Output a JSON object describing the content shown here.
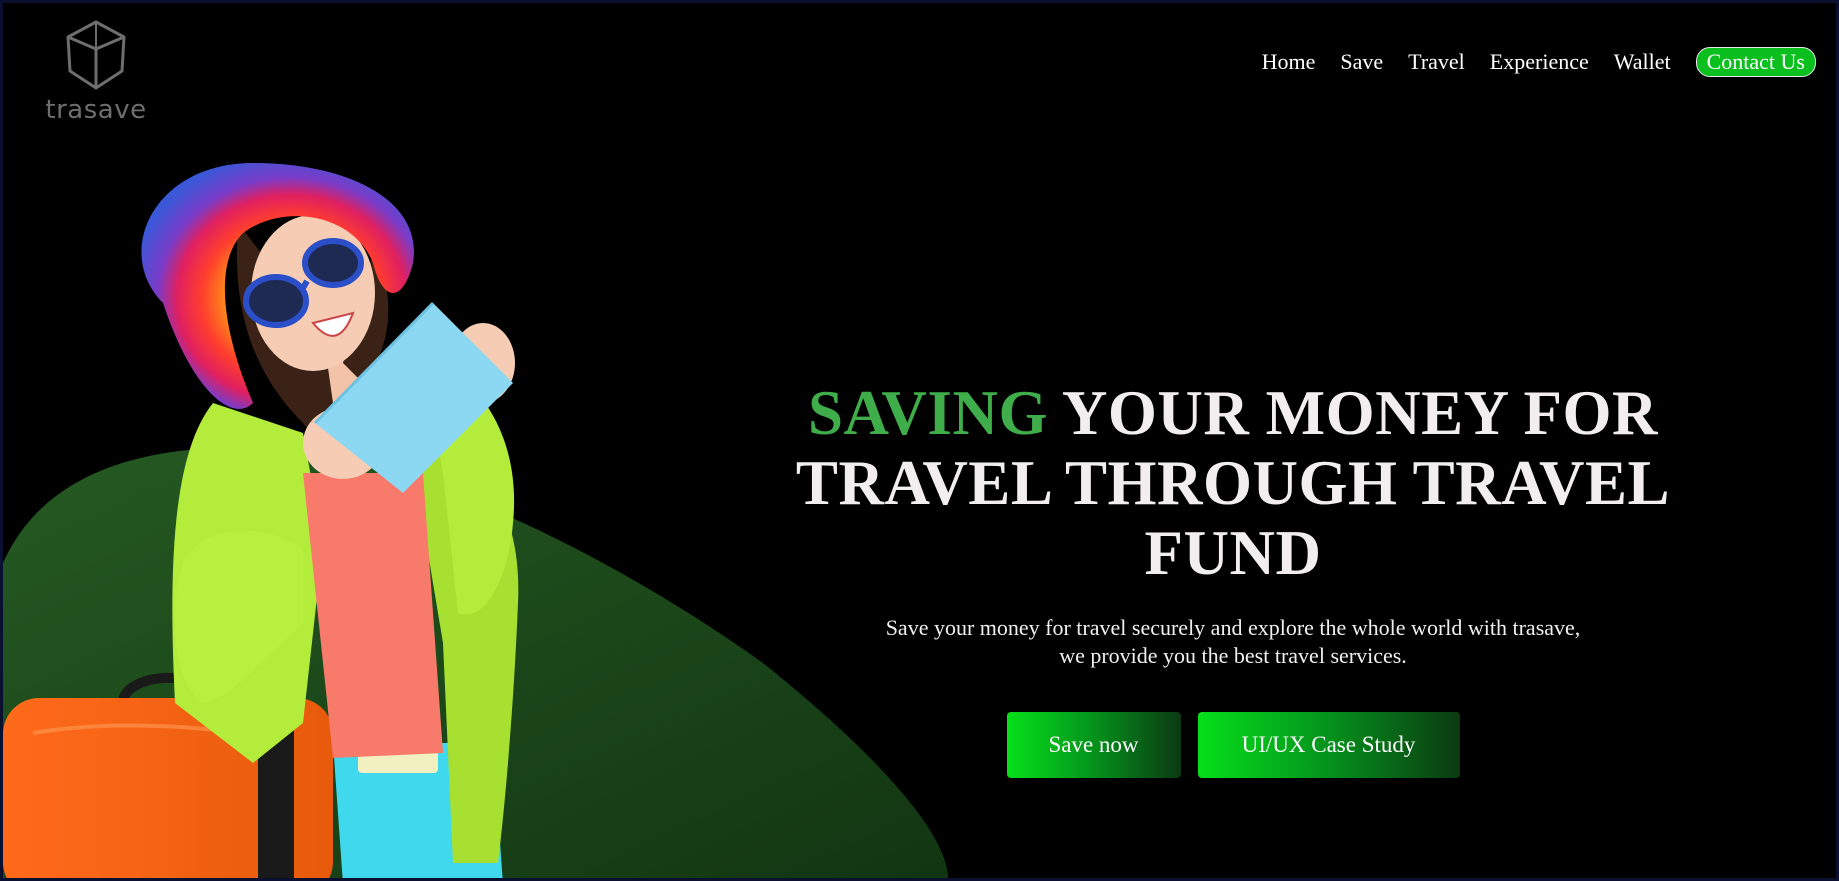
{
  "brand": {
    "name": "trasave",
    "logo_icon": "cube-icon"
  },
  "nav": {
    "items": [
      {
        "label": "Home"
      },
      {
        "label": "Save"
      },
      {
        "label": "Travel"
      },
      {
        "label": "Experience"
      },
      {
        "label": "Wallet"
      }
    ],
    "contact_label": "Contact Us"
  },
  "hero": {
    "headline_accent": "SAVING",
    "headline_rest_line1": " YOUR MONEY FOR",
    "headline_line2": "TRAVEL THROUGH TRAVEL",
    "headline_line3": "FUND",
    "subtext_line1": "Save your money for travel securely and explore the whole world with trasave,",
    "subtext_line2": "we provide you the best travel services.",
    "cta_primary": "Save now",
    "cta_secondary": "UI/UX Case Study"
  },
  "colors": {
    "background": "#000000",
    "accent_green": "#3fae4a",
    "button_green": "#05e019",
    "blob_green": "#1c4a1a"
  }
}
